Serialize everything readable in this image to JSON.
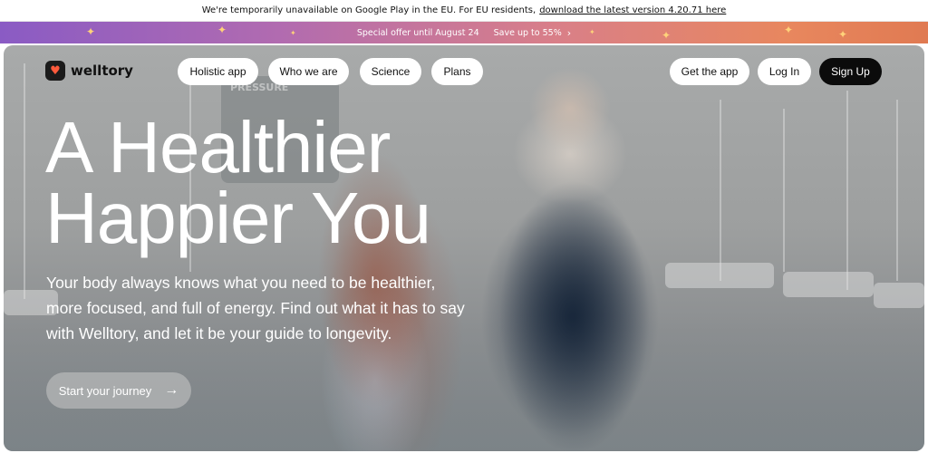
{
  "notice": {
    "text": "We're temporarily unavailable on Google Play in the EU. For EU residents,",
    "link": "download the latest version 4.20.71 here"
  },
  "promo": {
    "offer": "Special offer until August 24",
    "save": "Save up to 55%",
    "chevron_icon": "chevron-right-icon"
  },
  "nav": {
    "brand": "welltory",
    "logo_icon": "heart-logo-icon",
    "links": [
      "Holistic app",
      "Who we are",
      "Science",
      "Plans"
    ],
    "get_app": "Get the app",
    "login": "Log In",
    "signup": "Sign Up"
  },
  "hero": {
    "headline_line1": "A Healthier",
    "headline_line2": "Happier You",
    "subtext": "Your body always knows what you need to be healthier, more focused, and full of energy. Find out what it has to say with Welltory, and let it be your guide to longevity.",
    "cta": "Start your journey",
    "cta_icon": "arrow-right-icon",
    "background_card": "PRESSURE"
  },
  "colors": {
    "promo_gradient_start": "#8a5bc4",
    "promo_gradient_end": "#e07a52",
    "signup_bg": "#0b0b0b",
    "pill_bg": "#ffffff"
  }
}
